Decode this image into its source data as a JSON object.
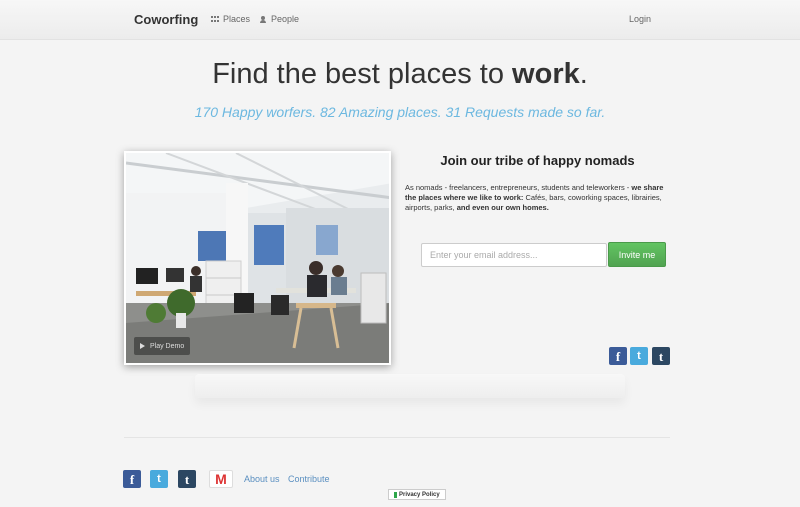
{
  "navbar": {
    "brand": "Coworfing",
    "places_label": "Places",
    "people_label": "People",
    "login_label": "Login"
  },
  "hero": {
    "title_prefix": "Find the best places to ",
    "title_bold": "work",
    "title_suffix": ".",
    "subtitle": "170 Happy worfers. 82 Amazing places. 31 Requests made so far."
  },
  "photo": {
    "play_label": "Play Demo"
  },
  "join": {
    "title": "Join our tribe of happy nomads",
    "desc_1": "As nomads - freelancers, entrepreneurs, students and teleworkers - ",
    "desc_bold_1": "we share the places where we like to work:",
    "desc_2": " Cafés, bars, coworking spaces, librairies, airports, parks, ",
    "desc_bold_2": "and even our own homes.",
    "email_placeholder": "Enter your email address...",
    "invite_label": "Invite me"
  },
  "social_icons": [
    {
      "name": "facebook-icon",
      "glyph": "f",
      "color": "#3b5b98"
    },
    {
      "name": "twitter-icon",
      "glyph": "t",
      "color": "#49aadd"
    },
    {
      "name": "tumblr-icon",
      "glyph": "t",
      "color": "#2c4762"
    }
  ],
  "footer": {
    "gmail_glyph": "M",
    "about_label": "About us",
    "contribute_label": "Contribute",
    "privacy_label": "Privacy Policy"
  }
}
